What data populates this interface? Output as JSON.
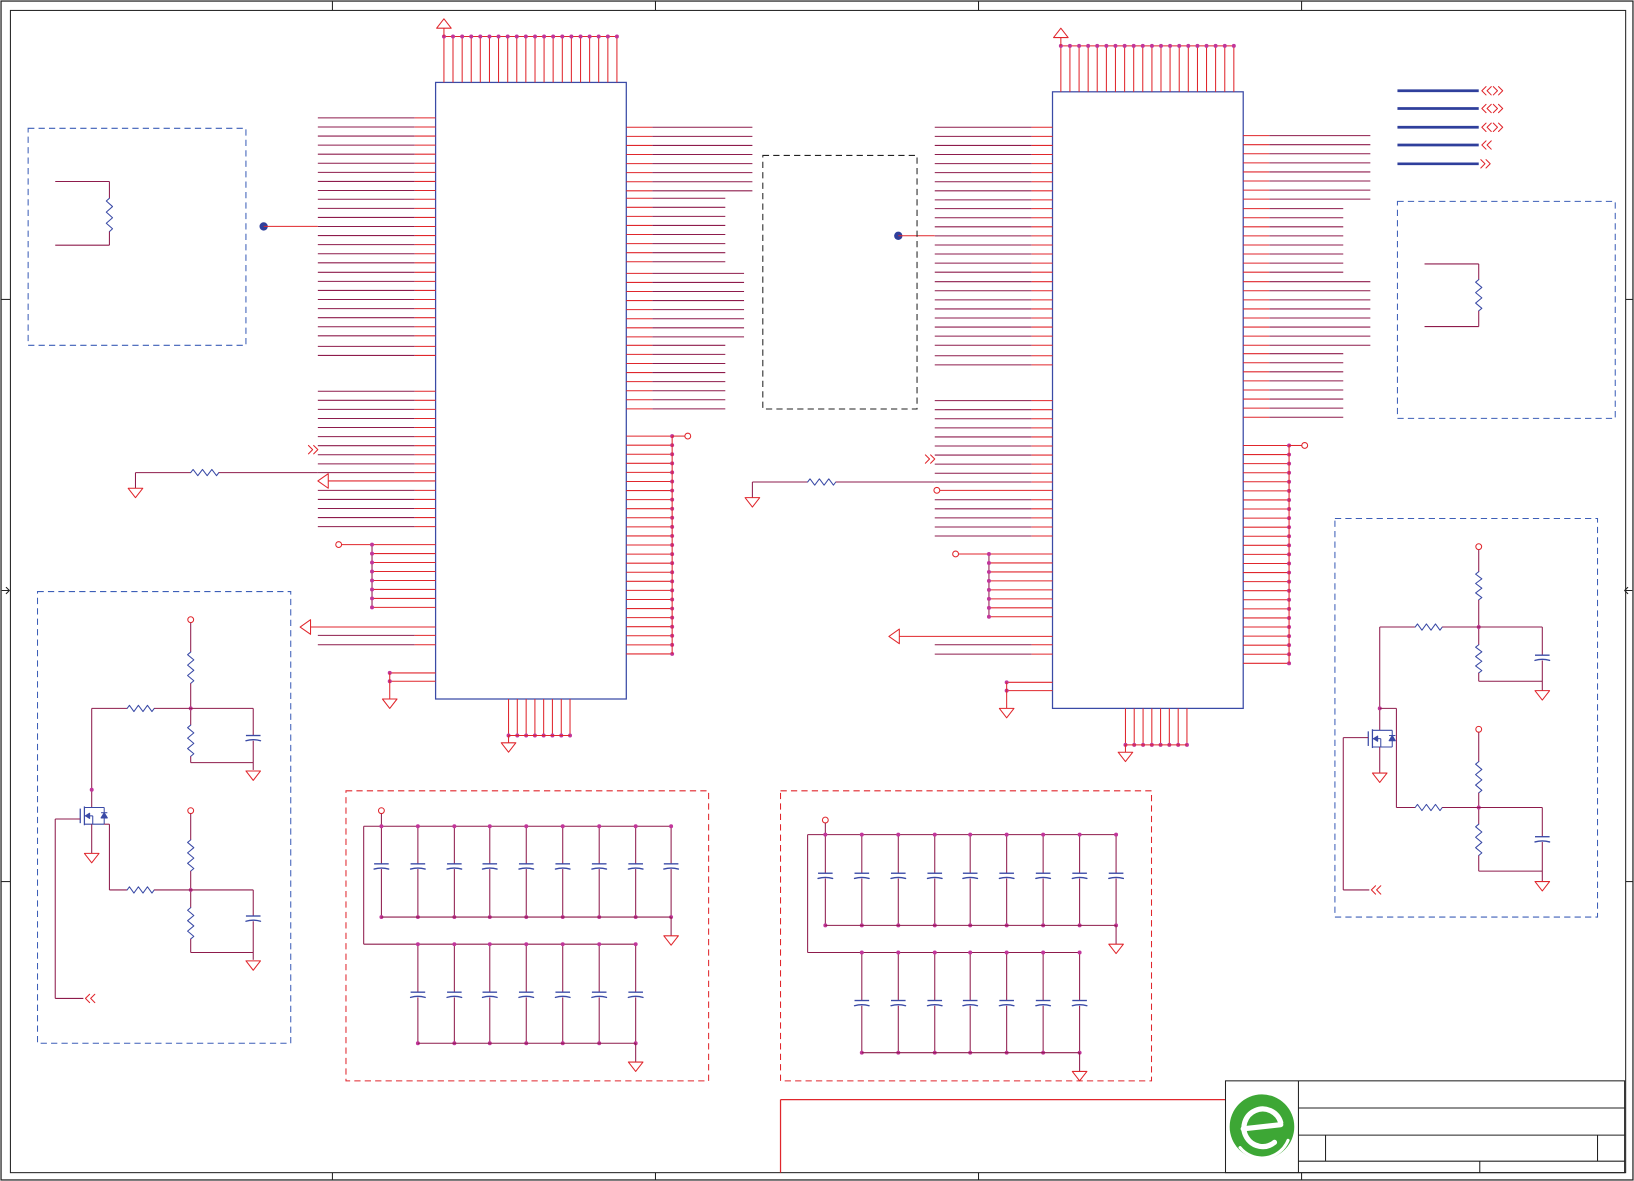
{
  "colors": {
    "wire": "#e0262c",
    "wire_dark": "#8e1b4c",
    "component": "#3a4aa6",
    "bus": "#2f3f9c",
    "junction": "#c2369b",
    "frame": "#222222",
    "box_blue": "#3d5fb8",
    "box_red": "#e0262c",
    "box_black": "#222222",
    "logo_green": "#3da735",
    "background": "#ffffff"
  }
}
